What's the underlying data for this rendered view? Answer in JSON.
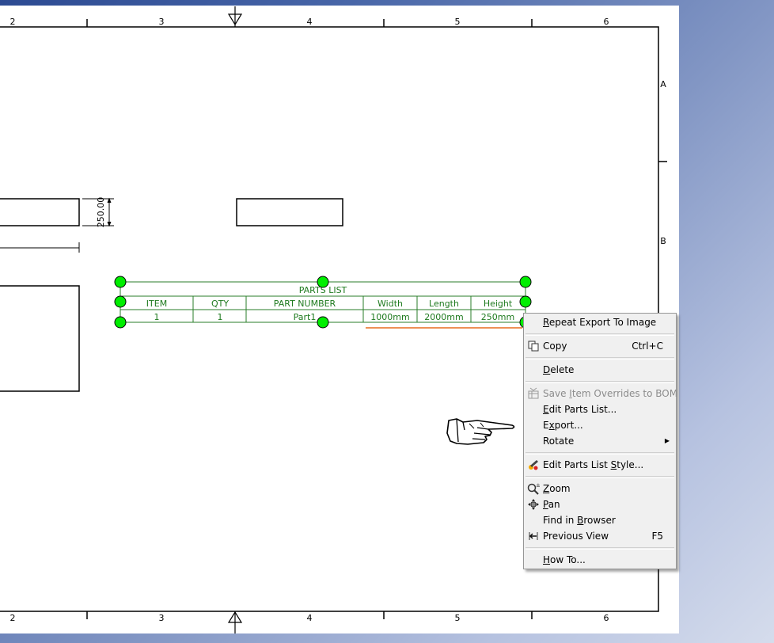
{
  "sheet": {
    "border_numbers_top": [
      "2",
      "3",
      "4",
      "5",
      "6"
    ],
    "border_numbers_bottom": [
      "2",
      "3",
      "4",
      "5",
      "6"
    ],
    "border_letters": [
      "A",
      "B"
    ]
  },
  "drawing": {
    "dimension_value": "250.00"
  },
  "parts_list": {
    "title": "PARTS LIST",
    "headers": [
      "ITEM",
      "QTY",
      "PART NUMBER",
      "Width",
      "Length",
      "Height"
    ],
    "rows": [
      [
        "1",
        "1",
        "Part1",
        "1000mm",
        "2000mm",
        "250mm"
      ]
    ],
    "grip_color": "#00ff00",
    "table_color": "#1e7a1e"
  },
  "context_menu": {
    "items": [
      {
        "label": "Repeat Export To Image",
        "mnemonic": "R",
        "icon": ""
      },
      {
        "separator": true
      },
      {
        "label": "Copy",
        "shortcut": "Ctrl+C",
        "icon": "copy-icon"
      },
      {
        "separator": true
      },
      {
        "label": "Delete",
        "mnemonic": "D",
        "icon": ""
      },
      {
        "separator": true
      },
      {
        "label": "Save Item Overrides to BOM",
        "mnemonic": "I",
        "disabled": true,
        "icon": "bom-icon"
      },
      {
        "label": "Edit Parts List...",
        "mnemonic": "E",
        "icon": ""
      },
      {
        "label": "Export...",
        "mnemonic": "x",
        "icon": ""
      },
      {
        "label": "Rotate",
        "submenu": true,
        "icon": ""
      },
      {
        "separator": true
      },
      {
        "label": "Edit Parts List Style...",
        "mnemonic": "S",
        "icon": "style-icon"
      },
      {
        "separator": true
      },
      {
        "label": "Zoom",
        "mnemonic": "Z",
        "icon": "zoom-icon"
      },
      {
        "label": "Pan",
        "mnemonic": "P",
        "icon": "pan-icon"
      },
      {
        "label": "Find in Browser",
        "mnemonic": "B",
        "icon": ""
      },
      {
        "label": "Previous View",
        "shortcut": "F5",
        "icon": "previous-view-icon"
      },
      {
        "separator": true
      },
      {
        "label": "How To...",
        "mnemonic": "H",
        "icon": ""
      }
    ]
  }
}
